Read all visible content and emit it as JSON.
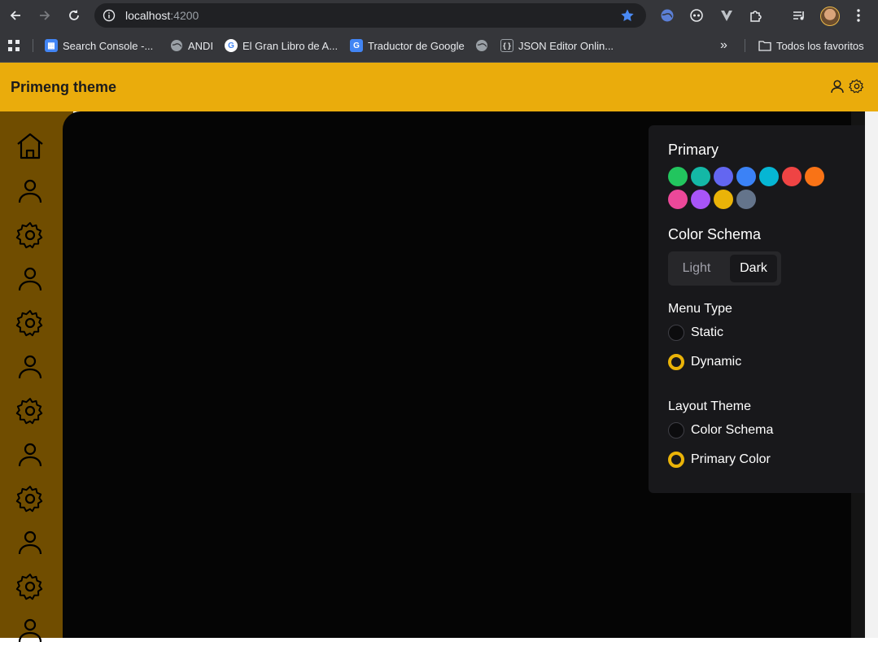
{
  "browser": {
    "url_host": "localhost",
    "url_port": ":4200",
    "bookmarks": [
      {
        "label": "Search Console -...",
        "icon": "search-console-icon"
      },
      {
        "label": "ANDI",
        "icon": "globe-icon"
      },
      {
        "label": "El Gran Libro de A...",
        "icon": "google-icon"
      },
      {
        "label": "Traductor de Google",
        "icon": "google-translate-icon"
      },
      {
        "label": "",
        "icon": "globe-icon"
      },
      {
        "label": "JSON Editor Onlin...",
        "icon": "json-icon"
      }
    ],
    "overflow_label": "»",
    "all_bookmarks_label": "Todos los favoritos"
  },
  "app": {
    "title": "Primeng theme",
    "header_color": "#eaac0c",
    "sidebar_color": "#704d00",
    "sidebar_items": [
      "home-icon",
      "user-icon",
      "gear-icon",
      "user-icon",
      "gear-icon",
      "user-icon",
      "gear-icon",
      "user-icon",
      "gear-icon",
      "user-icon",
      "gear-icon",
      "user-icon"
    ]
  },
  "config": {
    "primary_title": "Primary",
    "primary_colors": [
      "#22c55e",
      "#14b8a6",
      "#6366f1",
      "#3b82f6",
      "#06b6d4",
      "#ef4444",
      "#f97316",
      "#ec4899",
      "#a855f7",
      "#eab308",
      "#64748b"
    ],
    "color_schema_title": "Color Schema",
    "schema_options": {
      "light": "Light",
      "dark": "Dark"
    },
    "schema_selected": "Dark",
    "menu_type_title": "Menu Type",
    "menu_type_options": {
      "static": "Static",
      "dynamic": "Dynamic"
    },
    "menu_type_selected": "Dynamic",
    "layout_theme_title": "Layout Theme",
    "layout_theme_options": {
      "color_schema": "Color Schema",
      "primary_color": "Primary Color"
    },
    "layout_theme_selected": "Primary Color",
    "accent_color": "#eab308"
  }
}
